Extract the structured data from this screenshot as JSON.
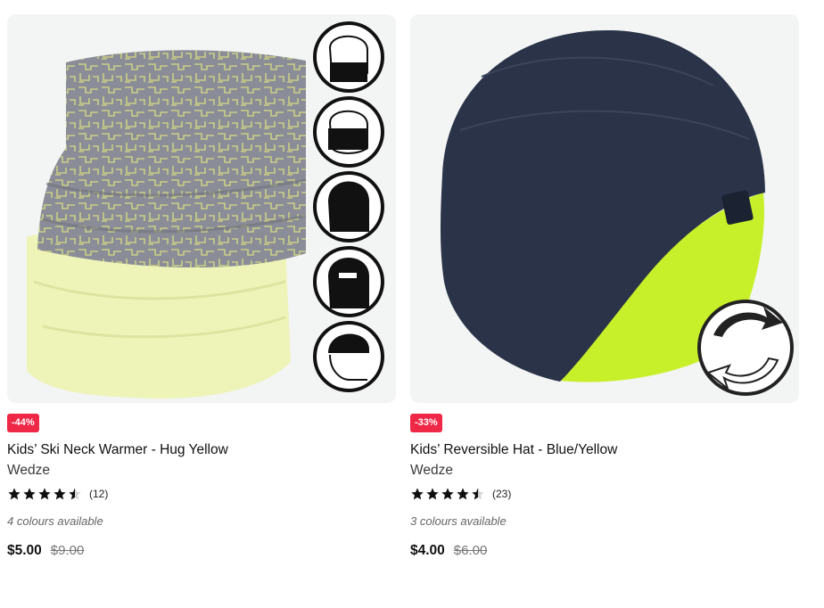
{
  "products": [
    {
      "discount": "-44%",
      "title": "Kids’ Ski Neck Warmer - Hug Yellow",
      "brand": "Wedze",
      "rating": 4.5,
      "review_count": "(12)",
      "colours": "4 colours available",
      "price": "$5.00",
      "old_price": "$9.00"
    },
    {
      "discount": "-33%",
      "title": "Kids’ Reversible Hat - Blue/Yellow",
      "brand": "Wedze",
      "rating": 4.5,
      "review_count": "(23)",
      "colours": "3 colours available",
      "price": "$4.00",
      "old_price": "$6.00"
    }
  ],
  "colors": {
    "badge": "#ee2846",
    "image_bg": "#f3f4f4",
    "neck_gray": "#8a8d97",
    "neck_fleece": "#eef3b8",
    "hat_navy": "#2a3348",
    "hat_lining": "#c8f02a"
  },
  "icons": [
    "star-icon",
    "wearing-style-icon",
    "reversible-arrows-icon"
  ]
}
